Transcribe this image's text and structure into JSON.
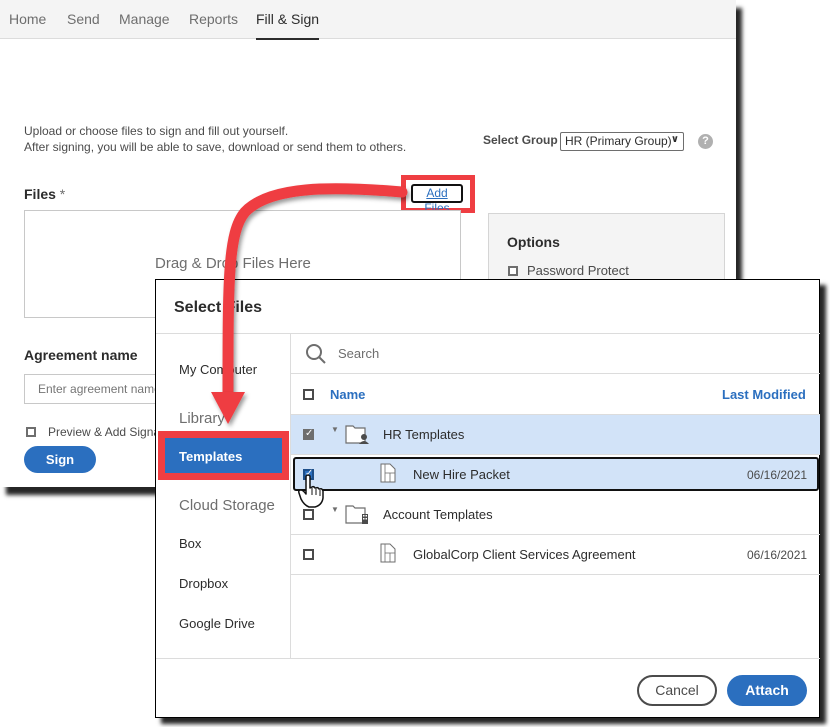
{
  "nav": {
    "tabs": [
      {
        "label": "Home"
      },
      {
        "label": "Send"
      },
      {
        "label": "Manage"
      },
      {
        "label": "Reports"
      },
      {
        "label": "Fill & Sign",
        "active": true
      }
    ]
  },
  "fill_sign": {
    "intro_line1": "Upload or choose files to sign and fill out yourself.",
    "intro_line2": "After signing, you will be able to save, download or send them to others.",
    "select_group_label": "Select Group",
    "select_group_value": "HR (Primary Group)",
    "help_icon": "?",
    "files_label": "Files",
    "required_mark": "*",
    "add_files_label": "Add Files",
    "dropzone_text": "Drag & Drop Files Here",
    "options_title": "Options",
    "password_protect_label": "Password Protect",
    "agreement_label": "Agreement name",
    "agreement_placeholder": "Enter agreement name",
    "preview_label": "Preview & Add Signature Fields",
    "sign_label": "Sign"
  },
  "dialog": {
    "title": "Select Files",
    "sidebar": {
      "my_computer": "My Computer",
      "library": "Library",
      "templates": "Templates",
      "cloud_storage": "Cloud Storage",
      "box": "Box",
      "dropbox": "Dropbox",
      "google_drive": "Google Drive"
    },
    "search_placeholder": "Search",
    "columns": {
      "name": "Name",
      "last_modified": "Last Modified"
    },
    "rows": [
      {
        "name": "HR Templates",
        "type": "shared-folder",
        "checked": true,
        "expanded": true,
        "modified": ""
      },
      {
        "name": "New Hire Packet",
        "type": "template",
        "checked": true,
        "modified": "06/16/2021"
      },
      {
        "name": "Account Templates",
        "type": "org-folder",
        "checked": false,
        "expanded": true,
        "modified": ""
      },
      {
        "name": "GlobalCorp Client Services Agreement",
        "type": "template",
        "checked": false,
        "modified": "06/16/2021"
      }
    ],
    "cancel_label": "Cancel",
    "attach_label": "Attach"
  },
  "colors": {
    "accent_blue": "#2b6fbf",
    "highlight_red": "#ef3e42",
    "selected_row": "#d2e3f8"
  }
}
